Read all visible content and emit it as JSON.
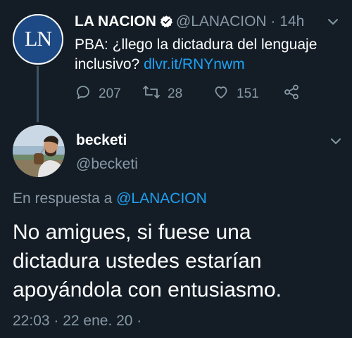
{
  "tweet1": {
    "avatar_text": "LN",
    "name": "LA NACION",
    "handle": "@LANACION",
    "separator": "·",
    "time": "14h",
    "text": "PBA: ¿llego la dictadura del lenguaje inclusivo?",
    "link": "dlvr.it/RNYnwm",
    "actions": {
      "replies": "207",
      "retweets": "28",
      "likes": "151"
    }
  },
  "tweet2": {
    "name": "becketi",
    "handle": "@becketi",
    "reply_prefix": "En respuesta a",
    "reply_handle": "@LANACION",
    "text": "No amigues, si fuese una dictadura ustedes estarían apoyándola con entusiasmo.",
    "timestamp": "22:03 · 22 ene. 20 ·"
  },
  "colors": {
    "background": "#141d26",
    "text": "#ffffff",
    "muted": "#8899a6",
    "link": "#1da1f2",
    "avatar_blue": "#1d4a85"
  },
  "icons": [
    "verified-icon",
    "chevron-down-icon",
    "reply-icon",
    "retweet-icon",
    "like-icon",
    "share-icon"
  ]
}
